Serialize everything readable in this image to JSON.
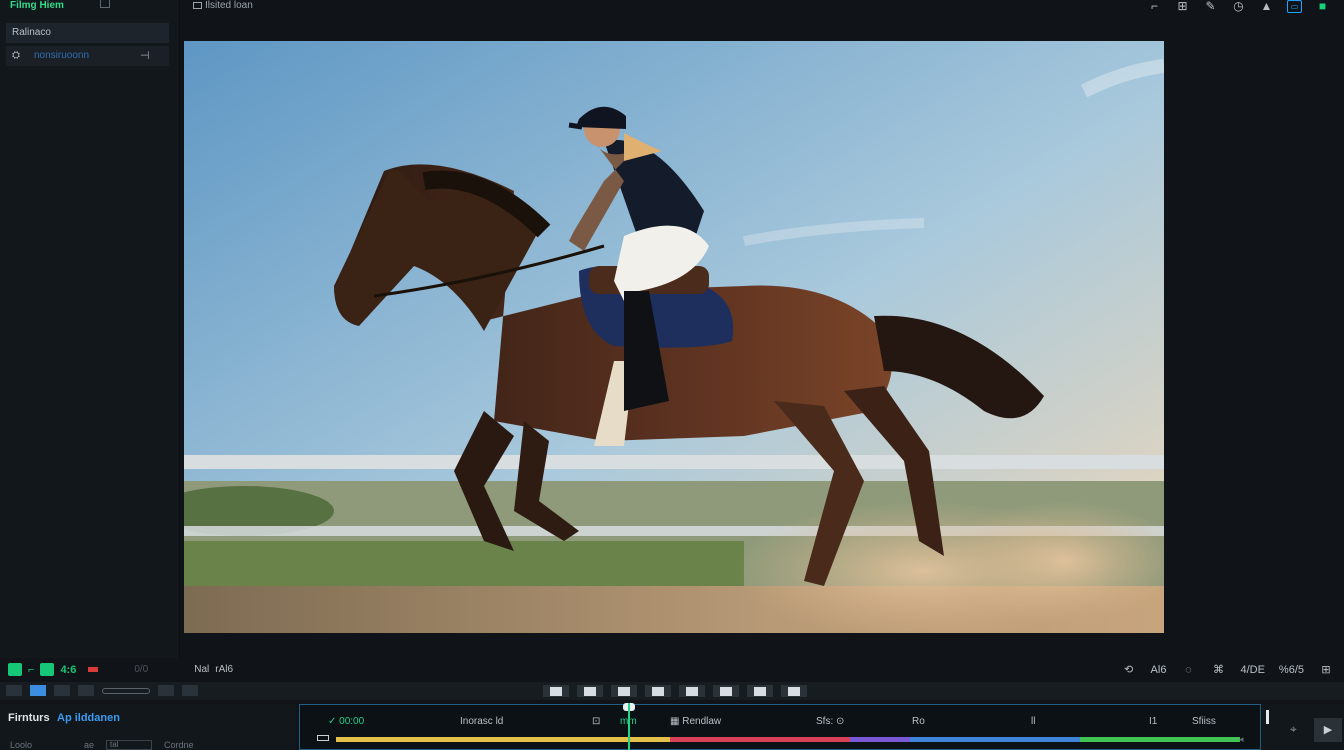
{
  "left_panel": {
    "tab_label": "Filmg Hiem",
    "header": "Ralinaco",
    "row_icon": "clip-icon",
    "row_label": "nonsiruoonn",
    "row_more": "⊣"
  },
  "topbar": {
    "title": "Ilsited loan",
    "icons": [
      "crop-icon",
      "layout-icon",
      "pen-icon",
      "clock-icon",
      "bell-icon",
      "export-icon",
      "share-icon"
    ]
  },
  "preview": {
    "description_icon": "video-frame"
  },
  "playbar": {
    "time_code": "4:6",
    "dim_label": "0/0",
    "label_1": "Nal",
    "label_2": "rAl6",
    "right_labels": [
      "Al6",
      "4/DE",
      "%6/5"
    ],
    "right_icons": [
      "loop-icon",
      "chat-icon",
      "link-icon",
      "cut-icon"
    ]
  },
  "bottom_left": {
    "title": "Firnturs",
    "title_accent": "Ap ilddanen",
    "row_label_1": "Loolo",
    "row_label_2": "ae",
    "row_box": "tal",
    "row_label_3": "Cordne"
  },
  "timeline": {
    "labels": [
      {
        "text": "✓ 00:00",
        "grn": true
      },
      {
        "text": "Inorasc ld"
      },
      {
        "text": "⊡"
      },
      {
        "text": "mm",
        "grn": true
      },
      {
        "text": "▦ Rendlaw"
      },
      {
        "text": "Sfs: ⊙"
      },
      {
        "text": "Ro"
      },
      {
        "text": "ll"
      },
      {
        "text": "I1"
      },
      {
        "text": "Sfiiss"
      }
    ],
    "segments": [
      {
        "color": "#e2c04a",
        "width": 334
      },
      {
        "color": "#d94157",
        "width": 180
      },
      {
        "color": "#7a58d6",
        "width": 60
      },
      {
        "color": "#3f84d9",
        "width": 170
      },
      {
        "color": "#42c455",
        "width": 160
      }
    ],
    "end_marker": "◂",
    "playhead_position": 0.34
  },
  "bottom_right": {
    "icon": "magic-icon",
    "button_label": "▶"
  },
  "colors": {
    "accent_green": "#17d47a",
    "accent_blue": "#1fa3ff",
    "background": "#101418"
  }
}
